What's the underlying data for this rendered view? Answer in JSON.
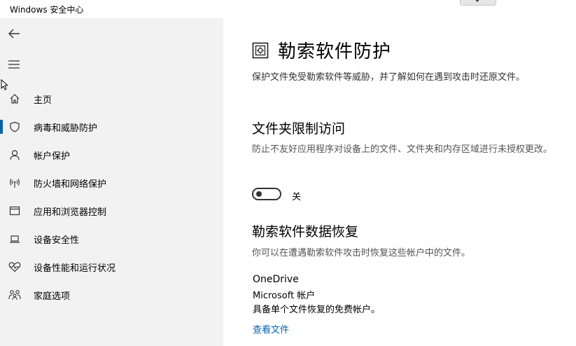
{
  "app": {
    "title": "Windows 安全中心"
  },
  "sidebar": {
    "back_icon": "back-arrow-icon",
    "menu_icon": "hamburger-menu-icon",
    "items": [
      {
        "label": "主页",
        "icon": "home-icon",
        "active": false
      },
      {
        "label": "病毒和威胁防护",
        "icon": "shield-icon",
        "active": true
      },
      {
        "label": "帐户保护",
        "icon": "person-icon",
        "active": false
      },
      {
        "label": "防火墙和网络保护",
        "icon": "wifi-antenna-icon",
        "active": false
      },
      {
        "label": "应用和浏览器控制",
        "icon": "app-window-icon",
        "active": false
      },
      {
        "label": "设备安全性",
        "icon": "laptop-icon",
        "active": false
      },
      {
        "label": "设备性能和运行状况",
        "icon": "heart-pulse-icon",
        "active": false
      },
      {
        "label": "家庭选项",
        "icon": "family-icon",
        "active": false
      }
    ]
  },
  "main": {
    "title": "勒索软件防护",
    "description": "保护文件免受勒索软件等威胁，并了解如何在遇到攻击时还原文件。",
    "cfa": {
      "heading": "文件夹限制访问",
      "description": "防止不友好应用程序对设备上的文件、文件夹和内存区域进行未授权更改。",
      "toggle_state": "关",
      "toggle_on": false
    },
    "recovery": {
      "heading": "勒索软件数据恢复",
      "description": "你可以在遭遇勒索软件攻击时恢复这些帐户中的文件。",
      "provider": "OneDrive",
      "account_type": "Microsoft 帐户",
      "plan": "具备单个文件恢复的免费帐户。",
      "link_label": "查看文件"
    }
  },
  "colors": {
    "accent": "#0063b1",
    "sidebar_bg": "#f2f2f2"
  }
}
